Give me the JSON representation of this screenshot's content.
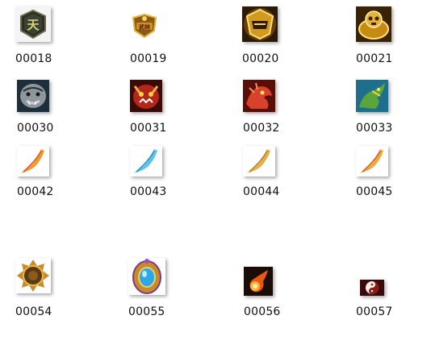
{
  "files": [
    {
      "name": "00018",
      "icon": "heaven-emblem-icon"
    },
    {
      "name": "00019",
      "icon": "gold-crest-badge-icon"
    },
    {
      "name": "00020",
      "icon": "gold-shield-emblem-icon"
    },
    {
      "name": "00021",
      "icon": "gold-skull-emblem-icon"
    },
    {
      "name": "00030",
      "icon": "grey-tiger-icon"
    },
    {
      "name": "00031",
      "icon": "red-beast-face-icon"
    },
    {
      "name": "00032",
      "icon": "red-dragon-icon"
    },
    {
      "name": "00033",
      "icon": "green-dragon-icon"
    },
    {
      "name": "00042",
      "icon": "orange-feather-icon"
    },
    {
      "name": "00043",
      "icon": "blue-feather-icon"
    },
    {
      "name": "00044",
      "icon": "gold-feather-icon"
    },
    {
      "name": "00045",
      "icon": "amber-feather-icon"
    },
    {
      "name": "00054",
      "icon": "bronze-amulet-icon"
    },
    {
      "name": "00055",
      "icon": "blue-gem-amulet-icon"
    },
    {
      "name": "00056",
      "icon": "fireball-icon"
    },
    {
      "name": "00057",
      "icon": "yin-yang-icon"
    }
  ]
}
